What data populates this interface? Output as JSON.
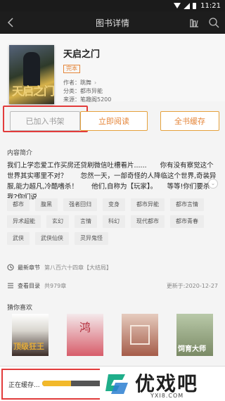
{
  "status_bar": {
    "time": "11:21"
  },
  "top_bar": {
    "title": "图书详情"
  },
  "book": {
    "title": "天启之门",
    "status_tag": "完本",
    "cover_title": "天启之门",
    "meta": [
      {
        "label": "作者：",
        "value": "跳舞",
        "has_arrow": true
      },
      {
        "label": "分类：",
        "value": "都市异能",
        "has_arrow": false
      },
      {
        "label": "来源：",
        "value": "笔趣阁5200",
        "has_arrow": false
      }
    ]
  },
  "actions": {
    "added": "已加入书架",
    "read": "立即阅读",
    "cache_all": "全书缓存"
  },
  "intro": {
    "heading": "内容简介",
    "text": "我们上学恋爱工作买房还贷刷微信吐槽看片......　　你有没有察觉这个世界其实哪里不对？　　忽然一天，一部奇怪的人降临这个世界,奇装异服,能力超凡,冷酷嗜杀！　　他们,自称为【玩家】。　　等等!你们要杀我?你们说"
  },
  "tags": [
    "都市",
    "腹黑",
    "强者回归",
    "变身",
    "都市异能",
    "都市言情",
    "异术超能",
    "玄幻",
    "言情",
    "科幻",
    "现代都市",
    "都市青春",
    "武侠",
    "武侠仙侠",
    "灵异鬼怪"
  ],
  "latest": {
    "label": "最新章节",
    "value": "第八百六十四章【大结局】"
  },
  "catalog": {
    "label": "查看目录",
    "count": "共979章",
    "updated": "更新于:2020-12-27"
  },
  "guess": {
    "heading": "猜你喜欢",
    "books": [
      {
        "cover_text": "顶级狂王"
      },
      {
        "cover_text": "鸿"
      },
      {
        "cover_text": ""
      },
      {
        "cover_text": "饲育大师"
      }
    ]
  },
  "bottom": {
    "cache_label": "正在缓存...",
    "progress": 0.45
  },
  "watermark": {
    "text": "优戏吧",
    "url": "YXI8.COM"
  },
  "colors": {
    "accent": "#e5863a",
    "highlight_box": "#e23b3b",
    "progress_fill": "#f2b92b"
  }
}
